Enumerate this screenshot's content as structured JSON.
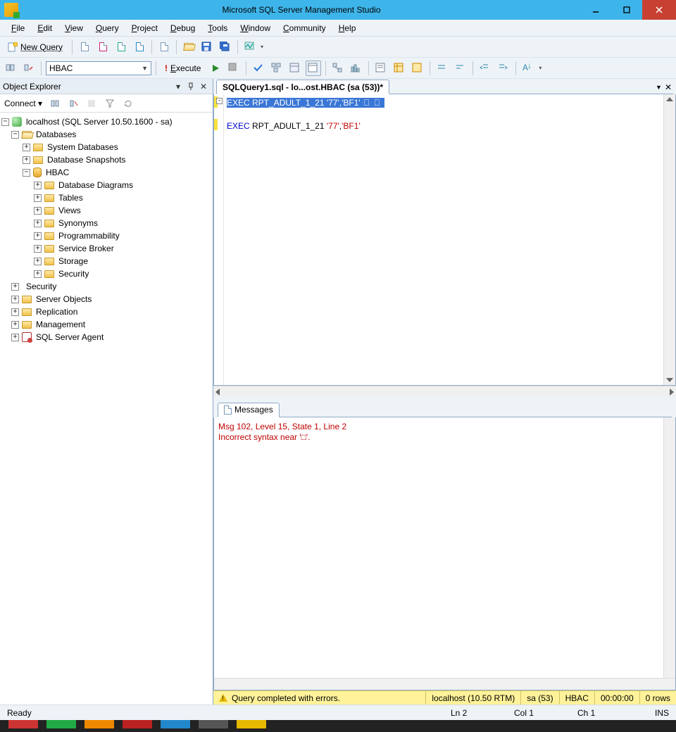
{
  "titlebar": {
    "title": "Microsoft SQL Server Management Studio"
  },
  "menu": [
    "File",
    "Edit",
    "View",
    "Query",
    "Project",
    "Debug",
    "Tools",
    "Window",
    "Community",
    "Help"
  ],
  "toolbar1": {
    "new_query": "New Query"
  },
  "toolbar2": {
    "db_selected": "HBAC",
    "execute": "Execute"
  },
  "object_explorer": {
    "title": "Object Explorer",
    "connect_label": "Connect",
    "server": "localhost (SQL Server 10.50.1600 - sa)",
    "nodes": {
      "databases": "Databases",
      "system_dbs": "System Databases",
      "db_snapshots": "Database Snapshots",
      "hbac": "HBAC",
      "db_diagrams": "Database Diagrams",
      "tables": "Tables",
      "views": "Views",
      "synonyms": "Synonyms",
      "programmability": "Programmability",
      "service_broker": "Service Broker",
      "storage": "Storage",
      "db_security": "Security",
      "security": "Security",
      "server_objects": "Server Objects",
      "replication": "Replication",
      "management": "Management",
      "sql_agent": "SQL Server Agent"
    }
  },
  "document": {
    "tab_title": "SQLQuery1.sql - lo...ost.HBAC (sa (53))*",
    "selected_line": "EXEC RPT_ADULT_1_21 '77','BF1'",
    "line2_kw": "EXEC",
    "line2_plain": " RPT_ADULT_1_21 ",
    "line2_str1": "'77'",
    "line2_comma": ",",
    "line2_str2": "'BF1'"
  },
  "messages": {
    "tab": "Messages",
    "line1": "Msg 102, Level 15, State 1, Line 2",
    "line2": "Incorrect syntax near '□'."
  },
  "query_status": {
    "text": "Query completed with errors.",
    "server": "localhost (10.50 RTM)",
    "user": "sa (53)",
    "db": "HBAC",
    "time": "00:00:00",
    "rows": "0 rows"
  },
  "statusbar": {
    "ready": "Ready",
    "ln": "Ln 2",
    "col": "Col 1",
    "ch": "Ch 1",
    "ins": "INS"
  }
}
